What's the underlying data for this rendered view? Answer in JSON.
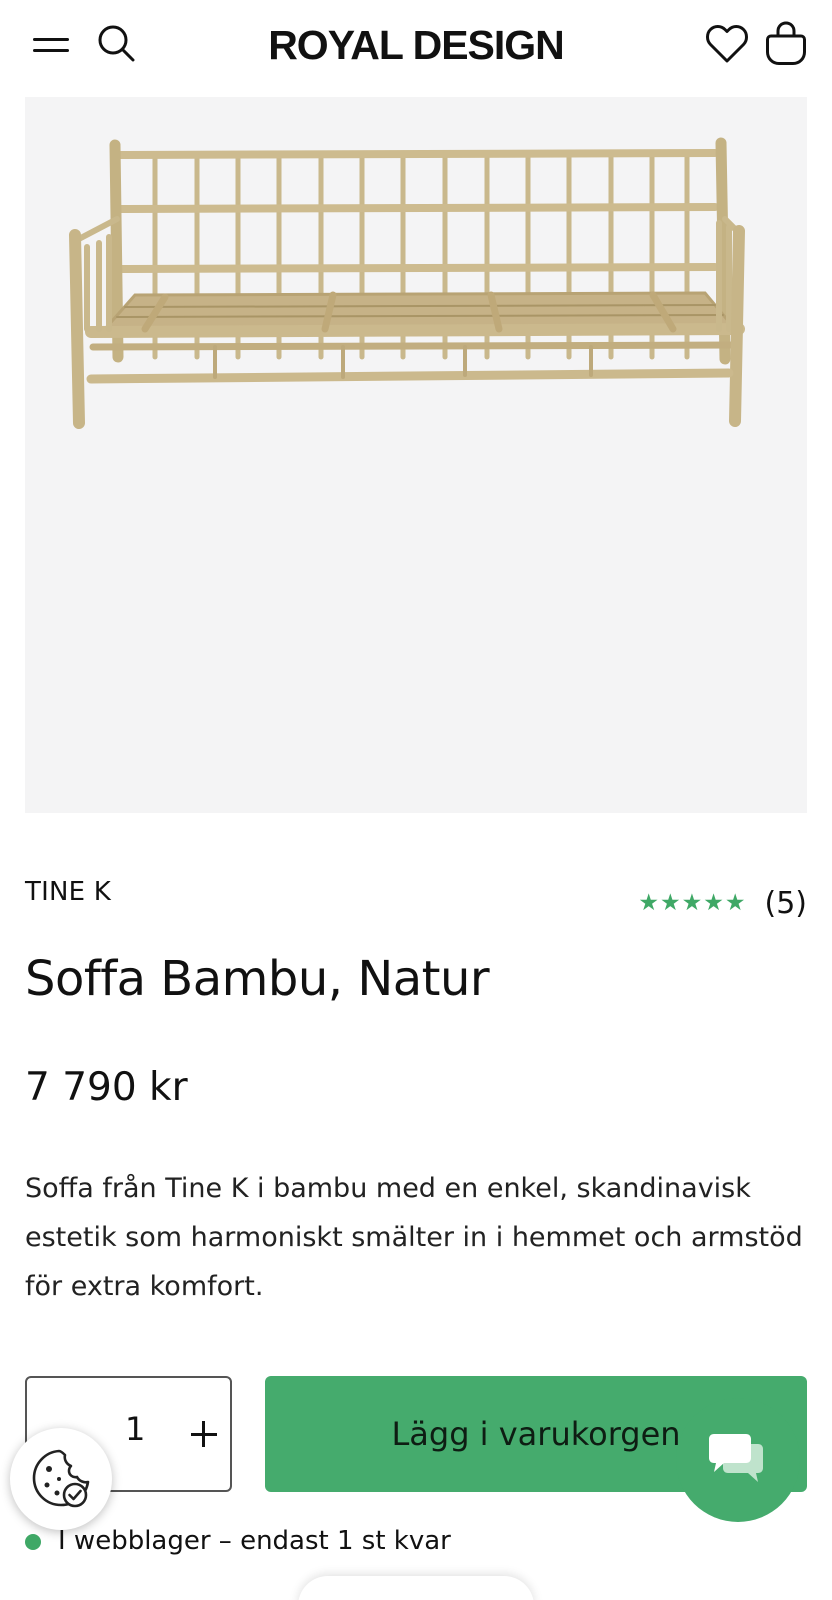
{
  "header": {
    "logo_text": "ROYAL DESIGN",
    "icons": [
      "menu-icon",
      "search-icon",
      "heart-icon",
      "shopping-bag-icon"
    ]
  },
  "product": {
    "brand": "TINE K",
    "rating_stars": "★★★★★",
    "rating_value": 5,
    "review_count": "(5)",
    "title": "Soffa Bambu, Natur",
    "price": "7 790 kr",
    "description": "Soffa från Tine K i bambu med en enkel, skandinavisk estetik som harmoniskt smälter in i hemmet och armstöd för extra komfort.",
    "image_icon": "bamboo-sofa-image"
  },
  "purchase": {
    "quantity": "1",
    "add_to_cart_label": "Lägg i varukorgen",
    "stock_status": "I webblager – endast 1 st kvar"
  },
  "colors": {
    "accent": "#45ab6d",
    "star": "#3fa866",
    "image_bg": "#f4f4f5"
  },
  "floating": {
    "chat_icon": "chat-bubbles-icon",
    "cookie_icon": "cookie-settings-icon"
  }
}
